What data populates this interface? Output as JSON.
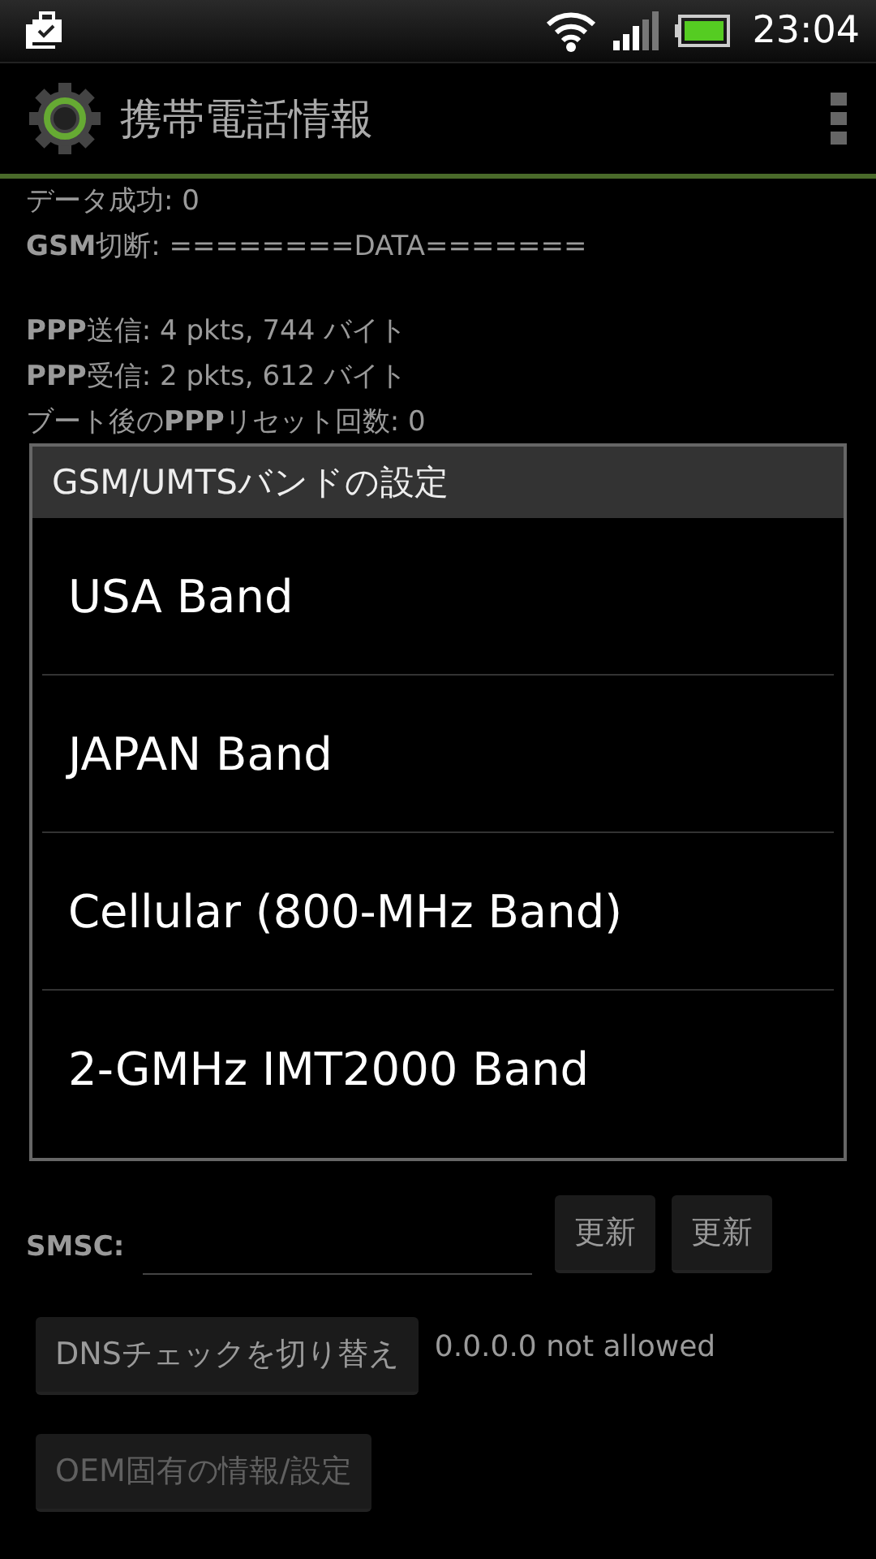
{
  "status_bar": {
    "time": "23:04"
  },
  "app_bar": {
    "title": "携帯電話情報"
  },
  "info_groups": [
    [
      "データ成功: 0",
      "**GSM**切断: ========DATA======="
    ],
    [
      "**PPP**送信: 4 pkts, 744 バイト",
      "**PPP**受信: 2 pkts, 612 バイト",
      "ブート後の**PPP**リセット回数: 0"
    ]
  ],
  "smsc": {
    "label": "SMSC:",
    "buttons": [
      "更新",
      "更新"
    ]
  },
  "dns": {
    "button": "DNSチェックを切り替え",
    "status": "0.0.0.0 not allowed"
  },
  "oem": {
    "button": "OEM固有の情報/設定",
    "disabled": true
  },
  "dialog": {
    "title": "GSM/UMTSバンドの設定",
    "options": [
      "USA Band",
      "JAPAN Band",
      "Cellular (800-MHz Band)",
      "2-GMHz IMT2000 Band"
    ]
  }
}
